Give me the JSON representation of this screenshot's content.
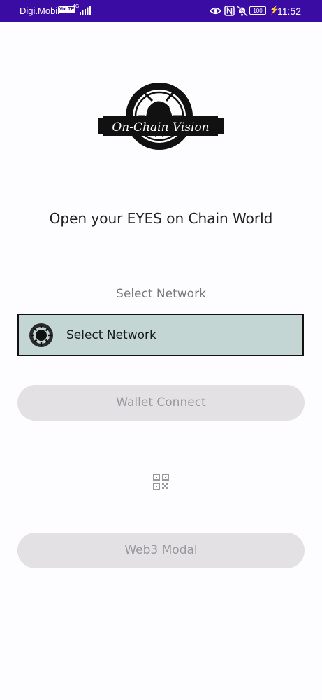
{
  "status_bar": {
    "carrier": "Digi.Mobil",
    "volte": "VoLTE",
    "network_type": "4G",
    "battery": "100",
    "time": "11:52"
  },
  "logo": {
    "text": "On-Chain Vision"
  },
  "tagline": "Open your EYES on Chain World",
  "network": {
    "section_label": "Select Network",
    "dropdown_label": "Select Network"
  },
  "buttons": {
    "wallet_connect": "Wallet Connect",
    "web3_modal": "Web3 Modal"
  },
  "icons": [
    "eye-icon",
    "nfc-icon",
    "mute-icon",
    "battery-icon",
    "qr-code-icon",
    "network-logo-icon"
  ],
  "colors": {
    "status_bar": "#3a0ca3",
    "dropdown_bg": "#c3d6d4",
    "button_bg": "#e3e1e4",
    "button_text": "#9a989c"
  }
}
